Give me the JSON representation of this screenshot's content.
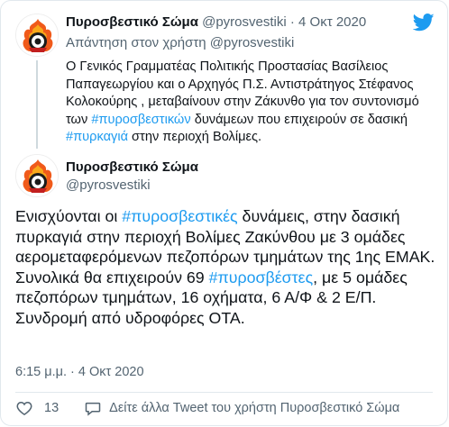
{
  "quoted_tweet": {
    "author_name": "Πυροσβεστικό Σώμα",
    "handle": "@pyrosvestiki",
    "separator": "·",
    "date": "4 Οκτ 2020",
    "reply_to": "Απάντηση στον χρήστη @pyrosvestiki",
    "text_parts": [
      "Ο Γενικός Γραμματέας Πολιτικής Προστασίας Βασίλειος Παπαγεωργίου και ο Αρχηγός Π.Σ. Αντιστράτηγος Στέφανος Κολοκούρης , μεταβαίνουν στην Ζάκυνθο για τον συντονισμό των ",
      "#πυροσβεστικών",
      " δυνάμεων που επιχειρούν σε δασική ",
      "#πυρκαγιά",
      " στην περιοχή Βολίμες."
    ]
  },
  "main_tweet": {
    "author_name": "Πυροσβεστικό Σώμα",
    "handle": "@pyrosvestiki",
    "text_parts": [
      "Ενισχύονται οι ",
      "#πυροσβεστικές",
      " δυνάμεις, στην δασική πυρκαγιά στην περιοχή Βολίμες Ζακύνθου με 3 ομάδες αερομεταφερόμενων πεζοπόρων τμημάτων της 1ης ΕΜΑΚ. Συνολικά θα επιχειρούν 69 ",
      "#πυροσβέστες",
      ", με 5 ομάδες πεζοπόρων τμημάτων, 16 οχήματα, 6 Α/Φ & 2 Ε/Π. Συνδρομή από υδροφόρες ΟΤΑ."
    ],
    "timestamp": "6:15 μ.μ. · 4 Οκτ 2020",
    "like_count": "13",
    "reply_cta": "Δείτε άλλα Tweet του χρήστη Πυροσβεστικό Σώμα"
  },
  "colors": {
    "hashtag": "#1d9bf0",
    "secondary_text": "#536471",
    "twitter_blue": "#1d9bf0"
  },
  "icons": {
    "brand": "twitter-bird-icon",
    "like": "heart-outline-icon",
    "reply": "speech-bubble-icon",
    "avatar_emblem": "fire-service-emblem"
  }
}
